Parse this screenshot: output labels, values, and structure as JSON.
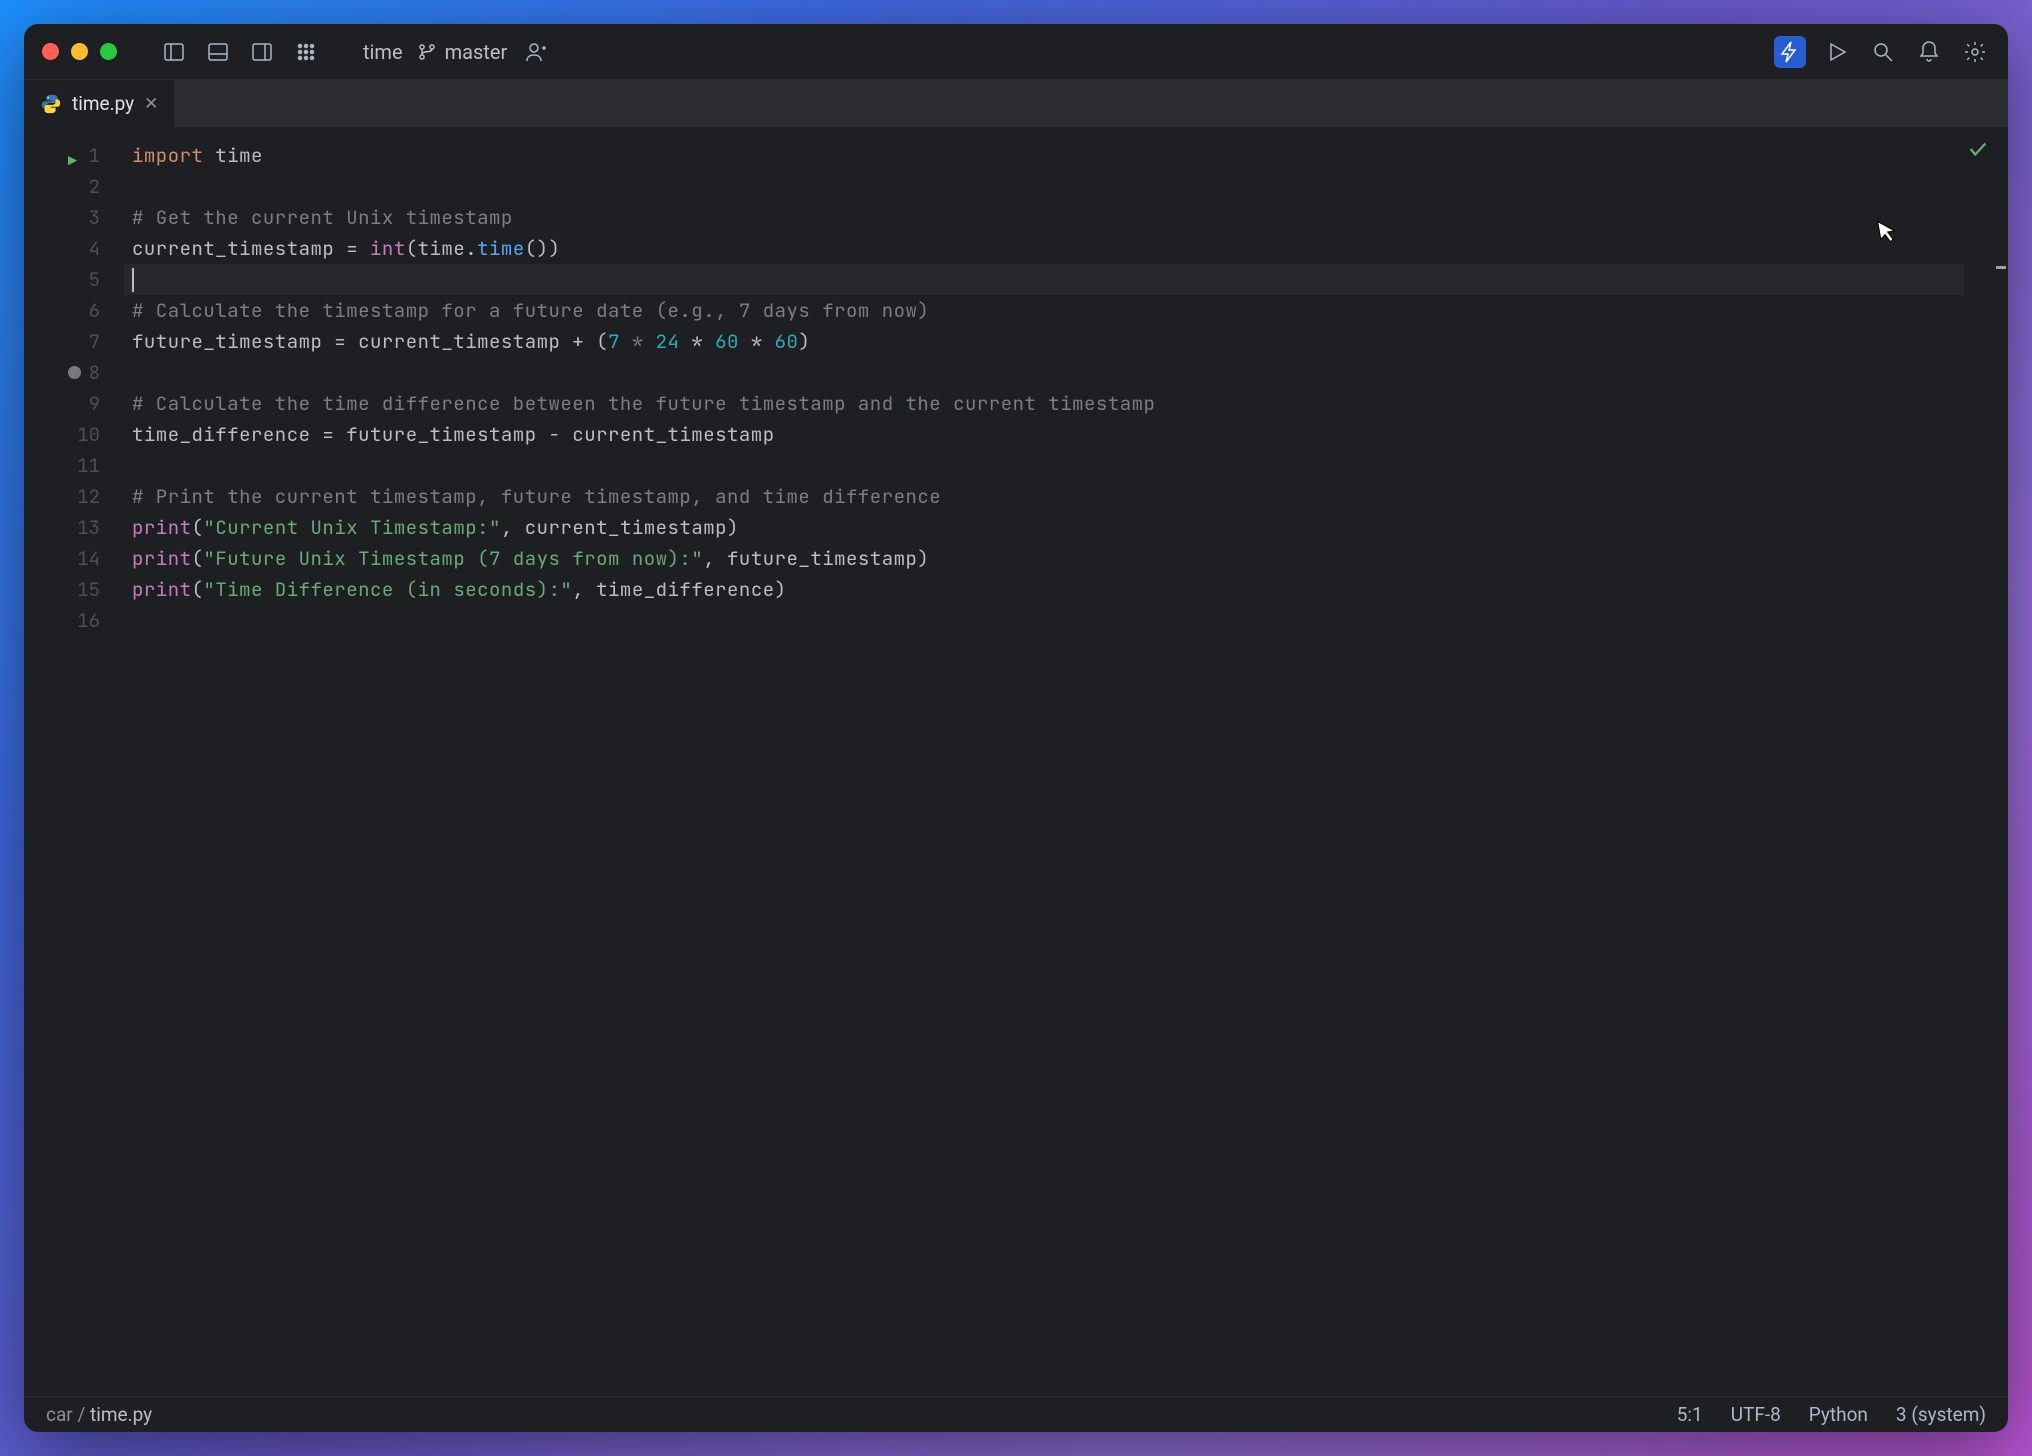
{
  "titlebar": {
    "project_name": "time",
    "branch": "master"
  },
  "tab": {
    "filename": "time.py"
  },
  "code": {
    "lines": [
      {
        "n": 1,
        "run": true,
        "segs": [
          {
            "t": "import",
            "c": "kw"
          },
          {
            "t": " time",
            "c": "id"
          }
        ]
      },
      {
        "n": 2,
        "segs": []
      },
      {
        "n": 3,
        "segs": [
          {
            "t": "# Get the current Unix timestamp",
            "c": "com"
          }
        ]
      },
      {
        "n": 4,
        "segs": [
          {
            "t": "current_timestamp = ",
            "c": "id"
          },
          {
            "t": "int",
            "c": "builtin"
          },
          {
            "t": "(time.",
            "c": "id"
          },
          {
            "t": "time",
            "c": "fn"
          },
          {
            "t": "())",
            "c": "id"
          }
        ]
      },
      {
        "n": 5,
        "hl": true,
        "cursor": true,
        "segs": []
      },
      {
        "n": 6,
        "segs": [
          {
            "t": "# Calculate the timestamp for a future date (e.g., 7 days from now)",
            "c": "com"
          }
        ]
      },
      {
        "n": 7,
        "segs": [
          {
            "t": "future_timestamp = current_timestamp + (",
            "c": "id"
          },
          {
            "t": "7",
            "c": "num"
          },
          {
            "t": " * ",
            "c": "com"
          },
          {
            "t": "24",
            "c": "num"
          },
          {
            "t": " * ",
            "c": "id"
          },
          {
            "t": "60",
            "c": "num"
          },
          {
            "t": " * ",
            "c": "id"
          },
          {
            "t": "60",
            "c": "num"
          },
          {
            "t": ")",
            "c": "id"
          }
        ]
      },
      {
        "n": 8,
        "dot": true,
        "segs": []
      },
      {
        "n": 9,
        "segs": [
          {
            "t": "# Calculate the time difference between the future timestamp and the current timestamp",
            "c": "com"
          }
        ]
      },
      {
        "n": 10,
        "segs": [
          {
            "t": "time_difference = future_timestamp - current_timestamp",
            "c": "id"
          }
        ]
      },
      {
        "n": 11,
        "segs": []
      },
      {
        "n": 12,
        "segs": [
          {
            "t": "# Print the current timestamp, future timestamp, and time difference",
            "c": "com"
          }
        ]
      },
      {
        "n": 13,
        "segs": [
          {
            "t": "print",
            "c": "builtin"
          },
          {
            "t": "(",
            "c": "id"
          },
          {
            "t": "\"Current Unix Timestamp:\"",
            "c": "str"
          },
          {
            "t": ", current_timestamp)",
            "c": "id"
          }
        ]
      },
      {
        "n": 14,
        "segs": [
          {
            "t": "print",
            "c": "builtin"
          },
          {
            "t": "(",
            "c": "id"
          },
          {
            "t": "\"Future Unix Timestamp (7 days from now):\"",
            "c": "str"
          },
          {
            "t": ", future_timestamp)",
            "c": "id"
          }
        ]
      },
      {
        "n": 15,
        "segs": [
          {
            "t": "print",
            "c": "builtin"
          },
          {
            "t": "(",
            "c": "id"
          },
          {
            "t": "\"Time Difference (in seconds):\"",
            "c": "str"
          },
          {
            "t": ", time_difference)",
            "c": "id"
          }
        ]
      },
      {
        "n": 16,
        "segs": []
      }
    ]
  },
  "statusbar": {
    "breadcrumb_folder": "car",
    "breadcrumb_file": "time.py",
    "cursor_pos": "5:1",
    "encoding": "UTF-8",
    "language": "Python",
    "interpreter": "3 (system)"
  }
}
